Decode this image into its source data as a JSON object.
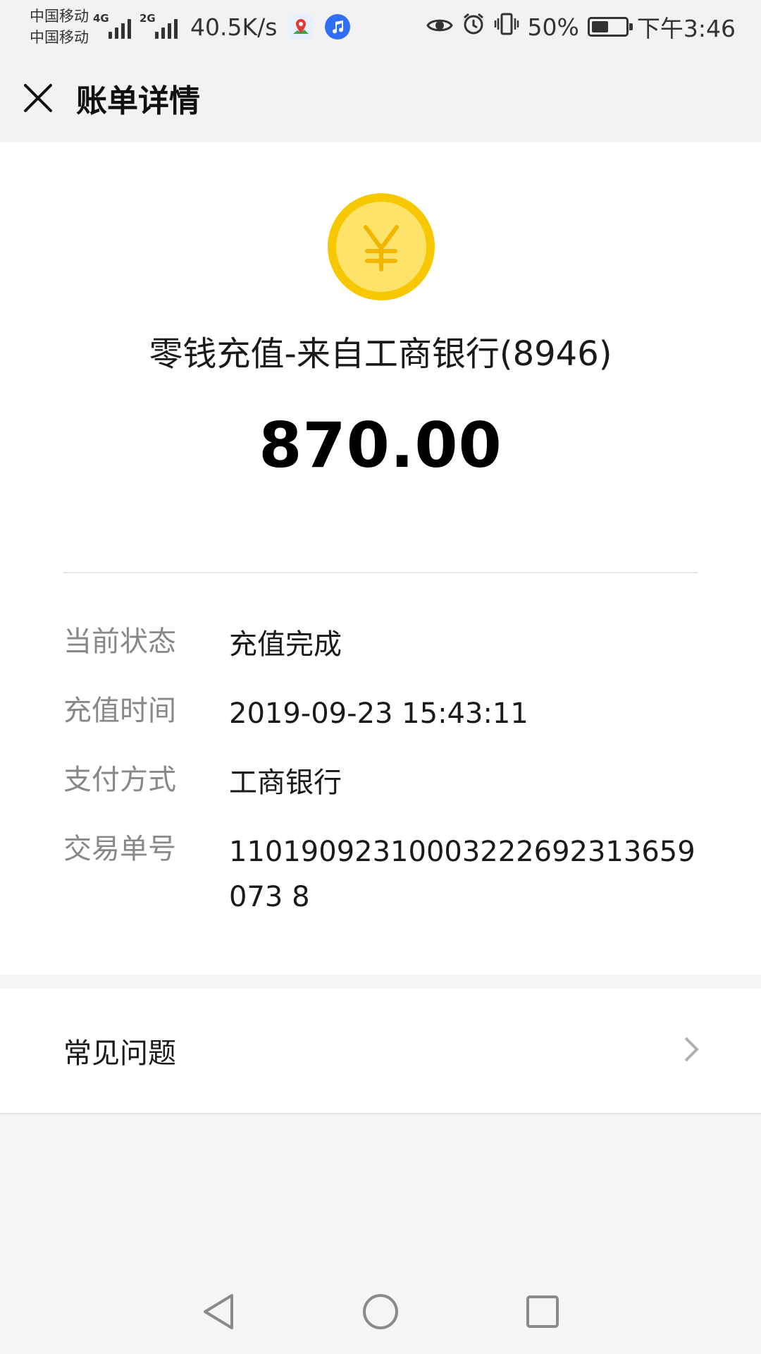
{
  "status_bar": {
    "carrier_1": "中国移动",
    "carrier_2": "中国移动",
    "net_1": "4G",
    "net_2": "2G",
    "speed": "40.5K/s",
    "battery_percent": "50%",
    "battery_level": 0.5,
    "time": "下午3:46"
  },
  "header": {
    "title": "账单详情"
  },
  "bill": {
    "title": "零钱充值-来自工商银行(8946)",
    "amount": "870.00",
    "details": [
      {
        "label": "当前状态",
        "value": "充值完成"
      },
      {
        "label": "充值时间",
        "value": "2019-09-23 15:43:11"
      },
      {
        "label": "支付方式",
        "value": "工商银行"
      },
      {
        "label": "交易单号",
        "value": "11019092310003222692313659073 8"
      }
    ]
  },
  "faq": {
    "label": "常见问题"
  },
  "colors": {
    "coin_outer": "#f7c800",
    "coin_inner": "#fde36a",
    "coin_symbol": "#f2b600"
  }
}
